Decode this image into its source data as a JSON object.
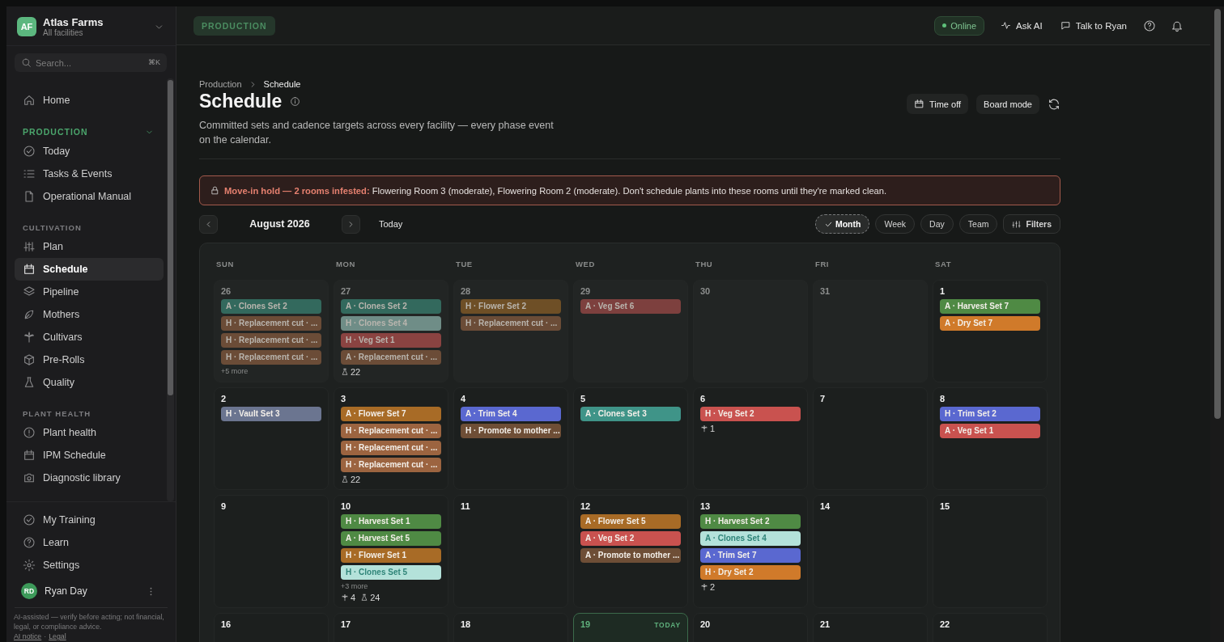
{
  "org": {
    "initials": "AF",
    "name": "Atlas Farms",
    "subtitle": "All facilities"
  },
  "search": {
    "placeholder": "Search...",
    "shortcut": "⌘K"
  },
  "nav": [
    {
      "kind": "item",
      "label": "Home",
      "selected": false
    },
    {
      "kind": "section",
      "label": "PRODUCTION",
      "active": true
    },
    {
      "kind": "item",
      "label": "Today",
      "selected": false
    },
    {
      "kind": "item",
      "label": "Tasks & Events",
      "selected": false
    },
    {
      "kind": "item",
      "label": "Operational Manual",
      "selected": false
    },
    {
      "kind": "section",
      "label": "CULTIVATION",
      "active": false
    },
    {
      "kind": "item",
      "label": "Plan",
      "selected": false
    },
    {
      "kind": "item",
      "label": "Schedule",
      "selected": true
    },
    {
      "kind": "item",
      "label": "Pipeline",
      "selected": false
    },
    {
      "kind": "item",
      "label": "Mothers",
      "selected": false
    },
    {
      "kind": "item",
      "label": "Cultivars",
      "selected": false
    },
    {
      "kind": "item",
      "label": "Pre-Rolls",
      "selected": false
    },
    {
      "kind": "item",
      "label": "Quality",
      "selected": false
    },
    {
      "kind": "section",
      "label": "PLANT HEALTH",
      "active": false
    },
    {
      "kind": "item",
      "label": "Plant health",
      "selected": false
    },
    {
      "kind": "item",
      "label": "IPM Schedule",
      "selected": false
    },
    {
      "kind": "item",
      "label": "Diagnostic library",
      "selected": false
    }
  ],
  "footer_nav": [
    "My Training",
    "Learn",
    "Settings"
  ],
  "user": {
    "initials": "RD",
    "name": "Ryan Day"
  },
  "disclaimer": {
    "text": "AI-assisted — verify before acting; not financial, legal, or compliance advice.",
    "links": [
      "AI notice",
      "Legal"
    ],
    "separator": "·"
  },
  "topbar": {
    "badge": "PRODUCTION",
    "status": "Online",
    "actions": [
      "Ask AI",
      "Talk to Ryan"
    ]
  },
  "breadcrumb": [
    "Production",
    "Schedule"
  ],
  "title": "Schedule",
  "description": "Committed sets and cadence targets across every facility — every phase event on the calendar.",
  "header_buttons": [
    "Time off",
    "Board mode"
  ],
  "alert": {
    "text": "**Move-in hold — 2 rooms infested:** Flowering Room 3 (moderate), Flowering Room 2 (moderate). Don't schedule plants into these rooms until they're marked clean."
  },
  "calendar": {
    "month": "August 2026",
    "today_button": "Today",
    "filters": "Filters",
    "views": [
      {
        "label": "Month",
        "selected": true
      },
      {
        "label": "Week",
        "selected": false
      },
      {
        "label": "Day",
        "selected": false
      },
      {
        "label": "Team",
        "selected": false
      }
    ],
    "weekdays": [
      "SUN",
      "MON",
      "TUE",
      "WED",
      "THU",
      "FRI",
      "SAT"
    ],
    "weeks": [
      [
        {
          "day": "26",
          "muted": true,
          "events": [
            {
              "label": "A · Clones Set 2",
              "color": "#33695d"
            },
            {
              "label": "H · Replacement cut · ...",
              "color": "#6b4c37"
            },
            {
              "label": "H · Replacement cut · ...",
              "color": "#6b4c37"
            },
            {
              "label": "H · Replacement cut · ...",
              "color": "#6b4c37"
            }
          ],
          "more": "+5 more"
        },
        {
          "day": "27",
          "muted": true,
          "events": [
            {
              "label": "A · Clones Set 2",
              "color": "#33695d"
            },
            {
              "label": "H · Clones Set 4",
              "color": "#6f8d87"
            },
            {
              "label": "H · Veg Set 1",
              "color": "#8a4341"
            },
            {
              "label": "A · Replacement cut · ...",
              "color": "#6b4c37"
            }
          ],
          "counts": [
            {
              "kind": "flask",
              "value": "22"
            }
          ]
        },
        {
          "day": "28",
          "muted": true,
          "events": [
            {
              "label": "H · Flower Set 2",
              "color": "#6e4f26"
            },
            {
              "label": "H · Replacement cut · ...",
              "color": "#6b4c37"
            }
          ]
        },
        {
          "day": "29",
          "muted": true,
          "events": [
            {
              "label": "A · Veg Set 6",
              "color": "#7d403e"
            }
          ]
        },
        {
          "day": "30",
          "muted": true
        },
        {
          "day": "31",
          "muted": true
        },
        {
          "day": "1",
          "muted": false,
          "events": [
            {
              "label": "A · Harvest Set 7",
              "color": "#4f8a44"
            },
            {
              "label": "A · Dry Set 7",
              "color": "#d07a2a"
            }
          ]
        }
      ],
      [
        {
          "day": "2",
          "muted": false,
          "events": [
            {
              "label": "H · Vault Set 3",
              "color": "#6b7590"
            }
          ]
        },
        {
          "day": "3",
          "muted": false,
          "events": [
            {
              "label": "A · Flower Set 7",
              "color": "#a86b26"
            },
            {
              "label": "H · Replacement cut · ...",
              "color": "#9c6440"
            },
            {
              "label": "H · Replacement cut · ...",
              "color": "#9c6440"
            },
            {
              "label": "H · Replacement cut · ...",
              "color": "#9c6440"
            }
          ],
          "counts": [
            {
              "kind": "flask",
              "value": "22"
            }
          ]
        },
        {
          "day": "4",
          "muted": false,
          "events": [
            {
              "label": "A · Trim Set 4",
              "color": "#5a68d0"
            },
            {
              "label": "H · Promote to mother ...",
              "color": "#6e4e36"
            }
          ]
        },
        {
          "day": "5",
          "muted": false,
          "events": [
            {
              "label": "A · Clones Set 3",
              "color": "#3f9488"
            }
          ]
        },
        {
          "day": "6",
          "muted": false,
          "events": [
            {
              "label": "H · Veg Set 2",
              "color": "#c9524f"
            }
          ],
          "counts": [
            {
              "kind": "plant",
              "value": "1"
            }
          ]
        },
        {
          "day": "7",
          "muted": false
        },
        {
          "day": "8",
          "muted": false,
          "events": [
            {
              "label": "H · Trim Set 2",
              "color": "#5a68d0"
            },
            {
              "label": "A · Veg Set 1",
              "color": "#c9524f"
            }
          ]
        }
      ],
      [
        {
          "day": "9",
          "muted": false
        },
        {
          "day": "10",
          "muted": false,
          "events": [
            {
              "label": "H · Harvest Set 1",
              "color": "#4f8a44"
            },
            {
              "label": "A · Harvest Set 5",
              "color": "#4f8a44"
            },
            {
              "label": "H · Flower Set 1",
              "color": "#a86b26"
            },
            {
              "label": "H · Clones Set 5",
              "color": "#b4e2da"
            }
          ],
          "more": "+3 more",
          "counts": [
            {
              "kind": "plant",
              "value": "4"
            },
            {
              "kind": "flask",
              "value": "24"
            }
          ]
        },
        {
          "day": "11",
          "muted": false
        },
        {
          "day": "12",
          "muted": false,
          "events": [
            {
              "label": "A · Flower Set 5",
              "color": "#a86b26"
            },
            {
              "label": "A · Veg Set 2",
              "color": "#c9524f"
            },
            {
              "label": "A · Promote to mother ...",
              "color": "#6e4e36"
            }
          ]
        },
        {
          "day": "13",
          "muted": false,
          "events": [
            {
              "label": "H · Harvest Set 2",
              "color": "#4f8a44"
            },
            {
              "label": "A · Clones Set 4",
              "color": "#b4e2da"
            },
            {
              "label": "A · Trim Set 7",
              "color": "#5a68d0"
            },
            {
              "label": "H · Dry Set 2",
              "color": "#d07a2a"
            }
          ],
          "counts": [
            {
              "kind": "plant",
              "value": "2"
            }
          ]
        },
        {
          "day": "14",
          "muted": false
        },
        {
          "day": "15",
          "muted": false
        }
      ],
      [
        {
          "day": "16",
          "muted": false
        },
        {
          "day": "17",
          "muted": false
        },
        {
          "day": "18",
          "muted": false
        },
        {
          "day": "19",
          "muted": false,
          "today": "TODAY"
        },
        {
          "day": "20",
          "muted": false
        },
        {
          "day": "21",
          "muted": false
        },
        {
          "day": "22",
          "muted": false
        }
      ]
    ]
  }
}
